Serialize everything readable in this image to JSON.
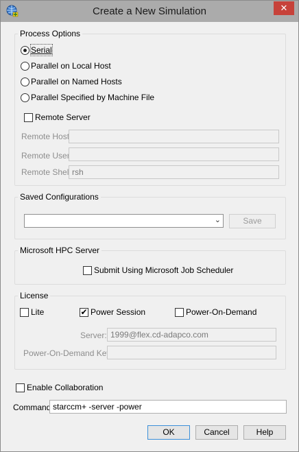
{
  "window": {
    "title": "Create a New Simulation",
    "close_glyph": "✕",
    "app_icon": "globe-icon"
  },
  "process_options": {
    "title": "Process Options",
    "radios": [
      {
        "label": "Serial",
        "checked": true
      },
      {
        "label": "Parallel on Local Host",
        "checked": false
      },
      {
        "label": "Parallel on Named Hosts",
        "checked": false
      },
      {
        "label": "Parallel Specified by Machine File",
        "checked": false
      }
    ],
    "remote_server": {
      "label": "Remote Server",
      "checked": false
    },
    "remote_host": {
      "label": "Remote Host:",
      "value": ""
    },
    "remote_user": {
      "label": "Remote User:",
      "value": ""
    },
    "remote_shell": {
      "label": "Remote Shell:",
      "value": "rsh"
    }
  },
  "saved_configurations": {
    "title": "Saved Configurations",
    "selected": "",
    "save_label": "Save"
  },
  "hpc": {
    "title": "Microsoft HPC Server",
    "submit": {
      "label": "Submit Using Microsoft Job Scheduler",
      "checked": false
    }
  },
  "license": {
    "title": "License",
    "lite": {
      "label": "Lite",
      "checked": false
    },
    "power_session": {
      "label": "Power Session",
      "checked": true
    },
    "power_on_demand": {
      "label": "Power-On-Demand",
      "checked": false
    },
    "server": {
      "label": "Server:",
      "value": "1999@flex.cd-adapco.com"
    },
    "pod_key": {
      "label": "Power-On-Demand Key:",
      "value": ""
    }
  },
  "collaboration": {
    "label": "Enable Collaboration",
    "checked": false
  },
  "command": {
    "label": "Command:",
    "value": "starccm+ -server -power"
  },
  "buttons": {
    "ok": "OK",
    "cancel": "Cancel",
    "help": "Help"
  }
}
